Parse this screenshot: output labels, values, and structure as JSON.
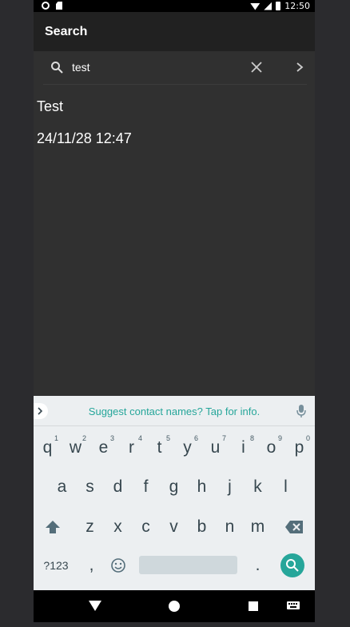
{
  "status": {
    "time": "12:50"
  },
  "toolbar": {
    "title": "Search"
  },
  "search": {
    "query": "test"
  },
  "result": {
    "title": "Test",
    "date": "24/11/28 12:47"
  },
  "keyboard": {
    "suggestion": "Suggest contact names? Tap for info.",
    "row1": [
      {
        "label": "q",
        "hint": "1"
      },
      {
        "label": "w",
        "hint": "2"
      },
      {
        "label": "e",
        "hint": "3"
      },
      {
        "label": "r",
        "hint": "4"
      },
      {
        "label": "t",
        "hint": "5"
      },
      {
        "label": "y",
        "hint": "6"
      },
      {
        "label": "u",
        "hint": "7"
      },
      {
        "label": "i",
        "hint": "8"
      },
      {
        "label": "o",
        "hint": "9"
      },
      {
        "label": "p",
        "hint": "0"
      }
    ],
    "row2": [
      "a",
      "s",
      "d",
      "f",
      "g",
      "h",
      "j",
      "k",
      "l"
    ],
    "row3": [
      "z",
      "x",
      "c",
      "v",
      "b",
      "n",
      "m"
    ],
    "symbols_label": "?123",
    "comma_label": ",",
    "period_label": "."
  },
  "colors": {
    "accent": "#26a69a",
    "toolbar": "#212121",
    "background": "#303030"
  }
}
